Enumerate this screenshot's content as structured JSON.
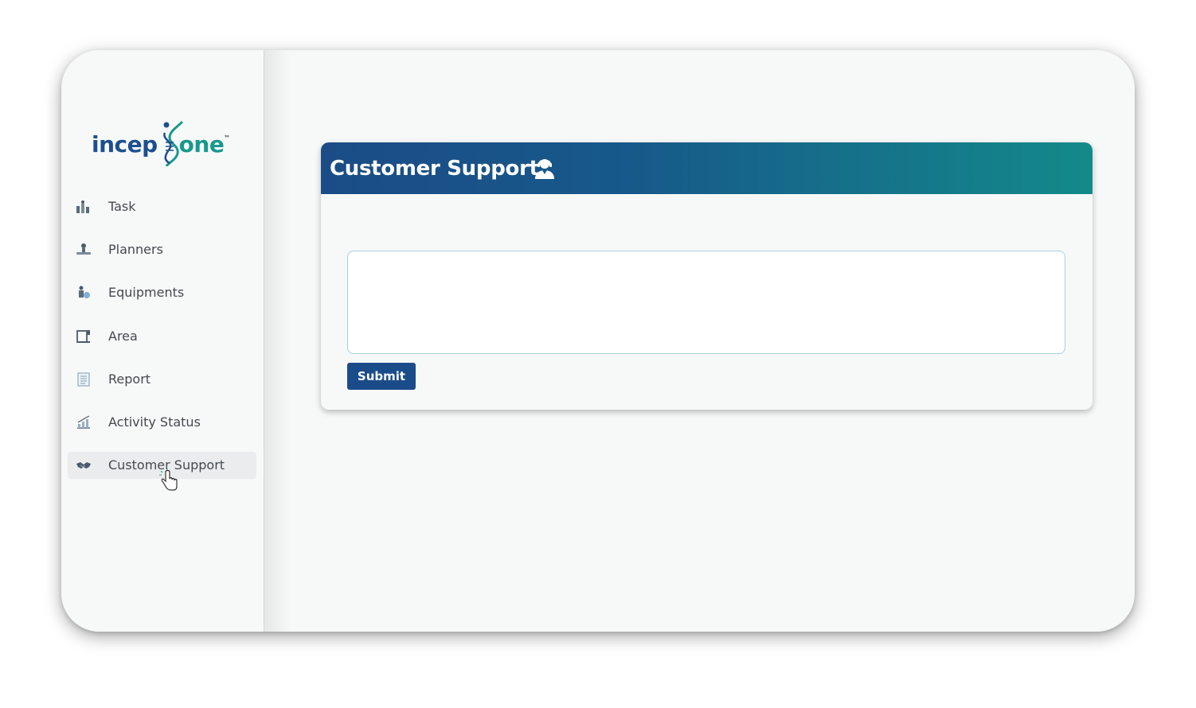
{
  "logo": {
    "incep": "incep",
    "one": "one",
    "tm": "™"
  },
  "sidebar": {
    "items": [
      {
        "label": "Task",
        "icon": "task-icon"
      },
      {
        "label": "Planners",
        "icon": "planners-icon"
      },
      {
        "label": "Equipments",
        "icon": "equipments-icon"
      },
      {
        "label": "Area",
        "icon": "area-icon"
      },
      {
        "label": "Report",
        "icon": "report-icon"
      },
      {
        "label": "Activity Status",
        "icon": "activity-status-icon"
      },
      {
        "label": "Customer Support",
        "icon": "handshake-icon",
        "active": true
      }
    ]
  },
  "main": {
    "title": "Customer Support",
    "title_icon": "support-agent-icon",
    "message": {
      "value": "",
      "placeholder": ""
    },
    "submit_label": "Submit"
  },
  "colors": {
    "brand_blue": "#1d4f8f",
    "brand_teal": "#17998e",
    "header_start": "#1b4c86",
    "header_end": "#138a8a",
    "button": "#1b4c8a"
  }
}
